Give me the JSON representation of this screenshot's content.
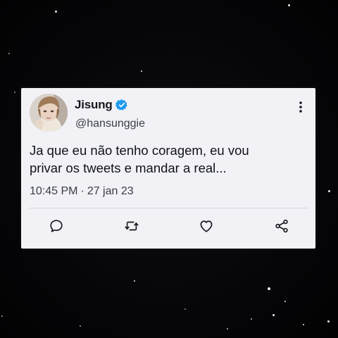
{
  "tweet": {
    "display_name": "Jisung",
    "handle": "@hansunggie",
    "text_line1": "Ja que eu não tenho coragem, eu vou",
    "text_line2": "privar os tweets e mandar a real...",
    "time": "10:45 PM",
    "separator": "·",
    "date": "27 jan 23"
  },
  "icons": {
    "verified": "verified-badge-icon",
    "more": "more-options-icon",
    "reply": "reply-icon",
    "retweet": "retweet-icon",
    "like": "like-icon",
    "share": "share-icon"
  },
  "colors": {
    "background": "#050507",
    "card": "#f1f1f6",
    "verified_blue": "#1d9bf0",
    "text": "#0f1419",
    "secondary_text": "#3a3f45"
  }
}
